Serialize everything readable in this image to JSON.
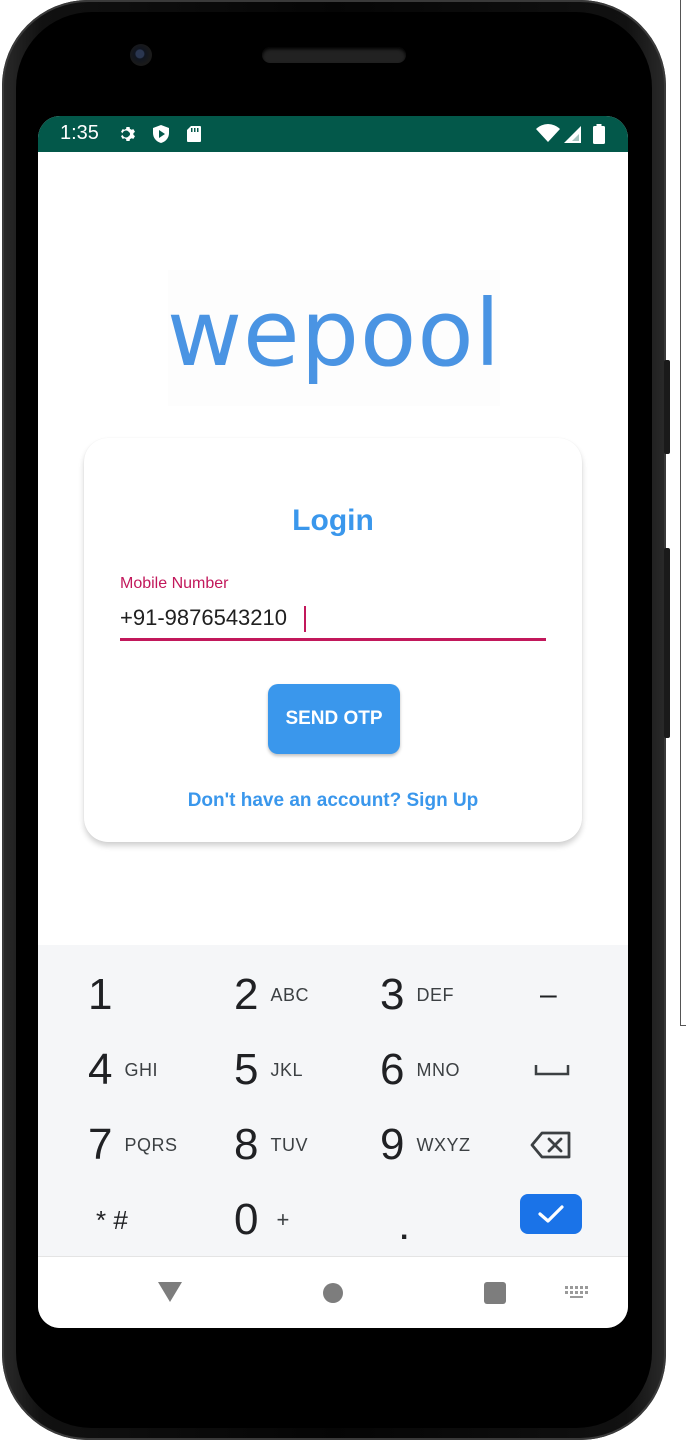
{
  "status_bar": {
    "time": "1:35",
    "bg_color": "#03584a",
    "icons": [
      "settings-icon",
      "shield-icon",
      "sd-card-icon",
      "wifi-icon",
      "signal-icon",
      "battery-icon"
    ]
  },
  "app": {
    "logo_text": "wepool",
    "brand_color": "#3a97ec"
  },
  "login_card": {
    "title": "Login",
    "mobile_field": {
      "label": "Mobile Number",
      "value": "+91-9876543210",
      "accent_color": "#c2185b"
    },
    "send_button_label": "SEND OTP",
    "signup_link": "Don't have an account? Sign Up"
  },
  "keypad": {
    "keys": [
      {
        "digit": "1",
        "letters": ""
      },
      {
        "digit": "2",
        "letters": "ABC"
      },
      {
        "digit": "3",
        "letters": "DEF"
      },
      {
        "digit": "4",
        "letters": "GHI"
      },
      {
        "digit": "5",
        "letters": "JKL"
      },
      {
        "digit": "6",
        "letters": "MNO"
      },
      {
        "digit": "7",
        "letters": "PQRS"
      },
      {
        "digit": "8",
        "letters": "TUV"
      },
      {
        "digit": "9",
        "letters": "WXYZ"
      },
      {
        "digit": "0",
        "letters": "+"
      }
    ],
    "star_hash": "* #",
    "minus": "–",
    "period": ".",
    "icons": [
      "space-icon",
      "backspace-icon",
      "check-icon"
    ],
    "done_color": "#1a73e8"
  },
  "nav_bar": {
    "icons": [
      "back-icon",
      "home-icon",
      "recents-icon",
      "keyboard-icon"
    ]
  }
}
